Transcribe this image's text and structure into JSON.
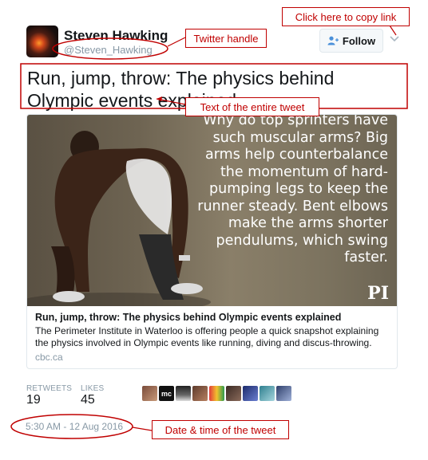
{
  "author": {
    "name": "Steven Hawking",
    "handle": "@Steven_Hawking"
  },
  "follow_button": {
    "label": "Follow",
    "icon": "add-user-icon"
  },
  "menu_icon": "chevron-down-icon",
  "tweet": {
    "text": "Run, jump, throw: The physics behind Olympic events explained"
  },
  "card": {
    "image_quote": "Why do top sprinters have such muscular arms? Big arms help counterbalance the momentum of hard-pumping legs to keep the runner steady. Bent elbows make the arms shorter pendulums, which swing faster.",
    "logo": "PI",
    "title": "Run, jump, throw: The physics behind Olympic events explained",
    "description": "The Perimeter Institute in Waterloo is offering people a quick snapshot explaining the physics involved in Olympic events like running, diving and discus-throwing.",
    "domain": "cbc.ca"
  },
  "stats": {
    "retweets_label": "RETWEETS",
    "retweets": "19",
    "likes_label": "LIKES",
    "likes": "45"
  },
  "likers_count_shown": 9,
  "timestamp": "5:30 AM - 12 Aug 2016",
  "annotations": {
    "copy_link": "Click here to copy link",
    "handle": "Twitter handle",
    "tweet_text": "Text of the entire tweet",
    "datetime": "Date & time of the tweet"
  },
  "colors": {
    "annotation_red": "#c00000",
    "muted_text": "#8899a6",
    "border": "#e1e8ed"
  }
}
